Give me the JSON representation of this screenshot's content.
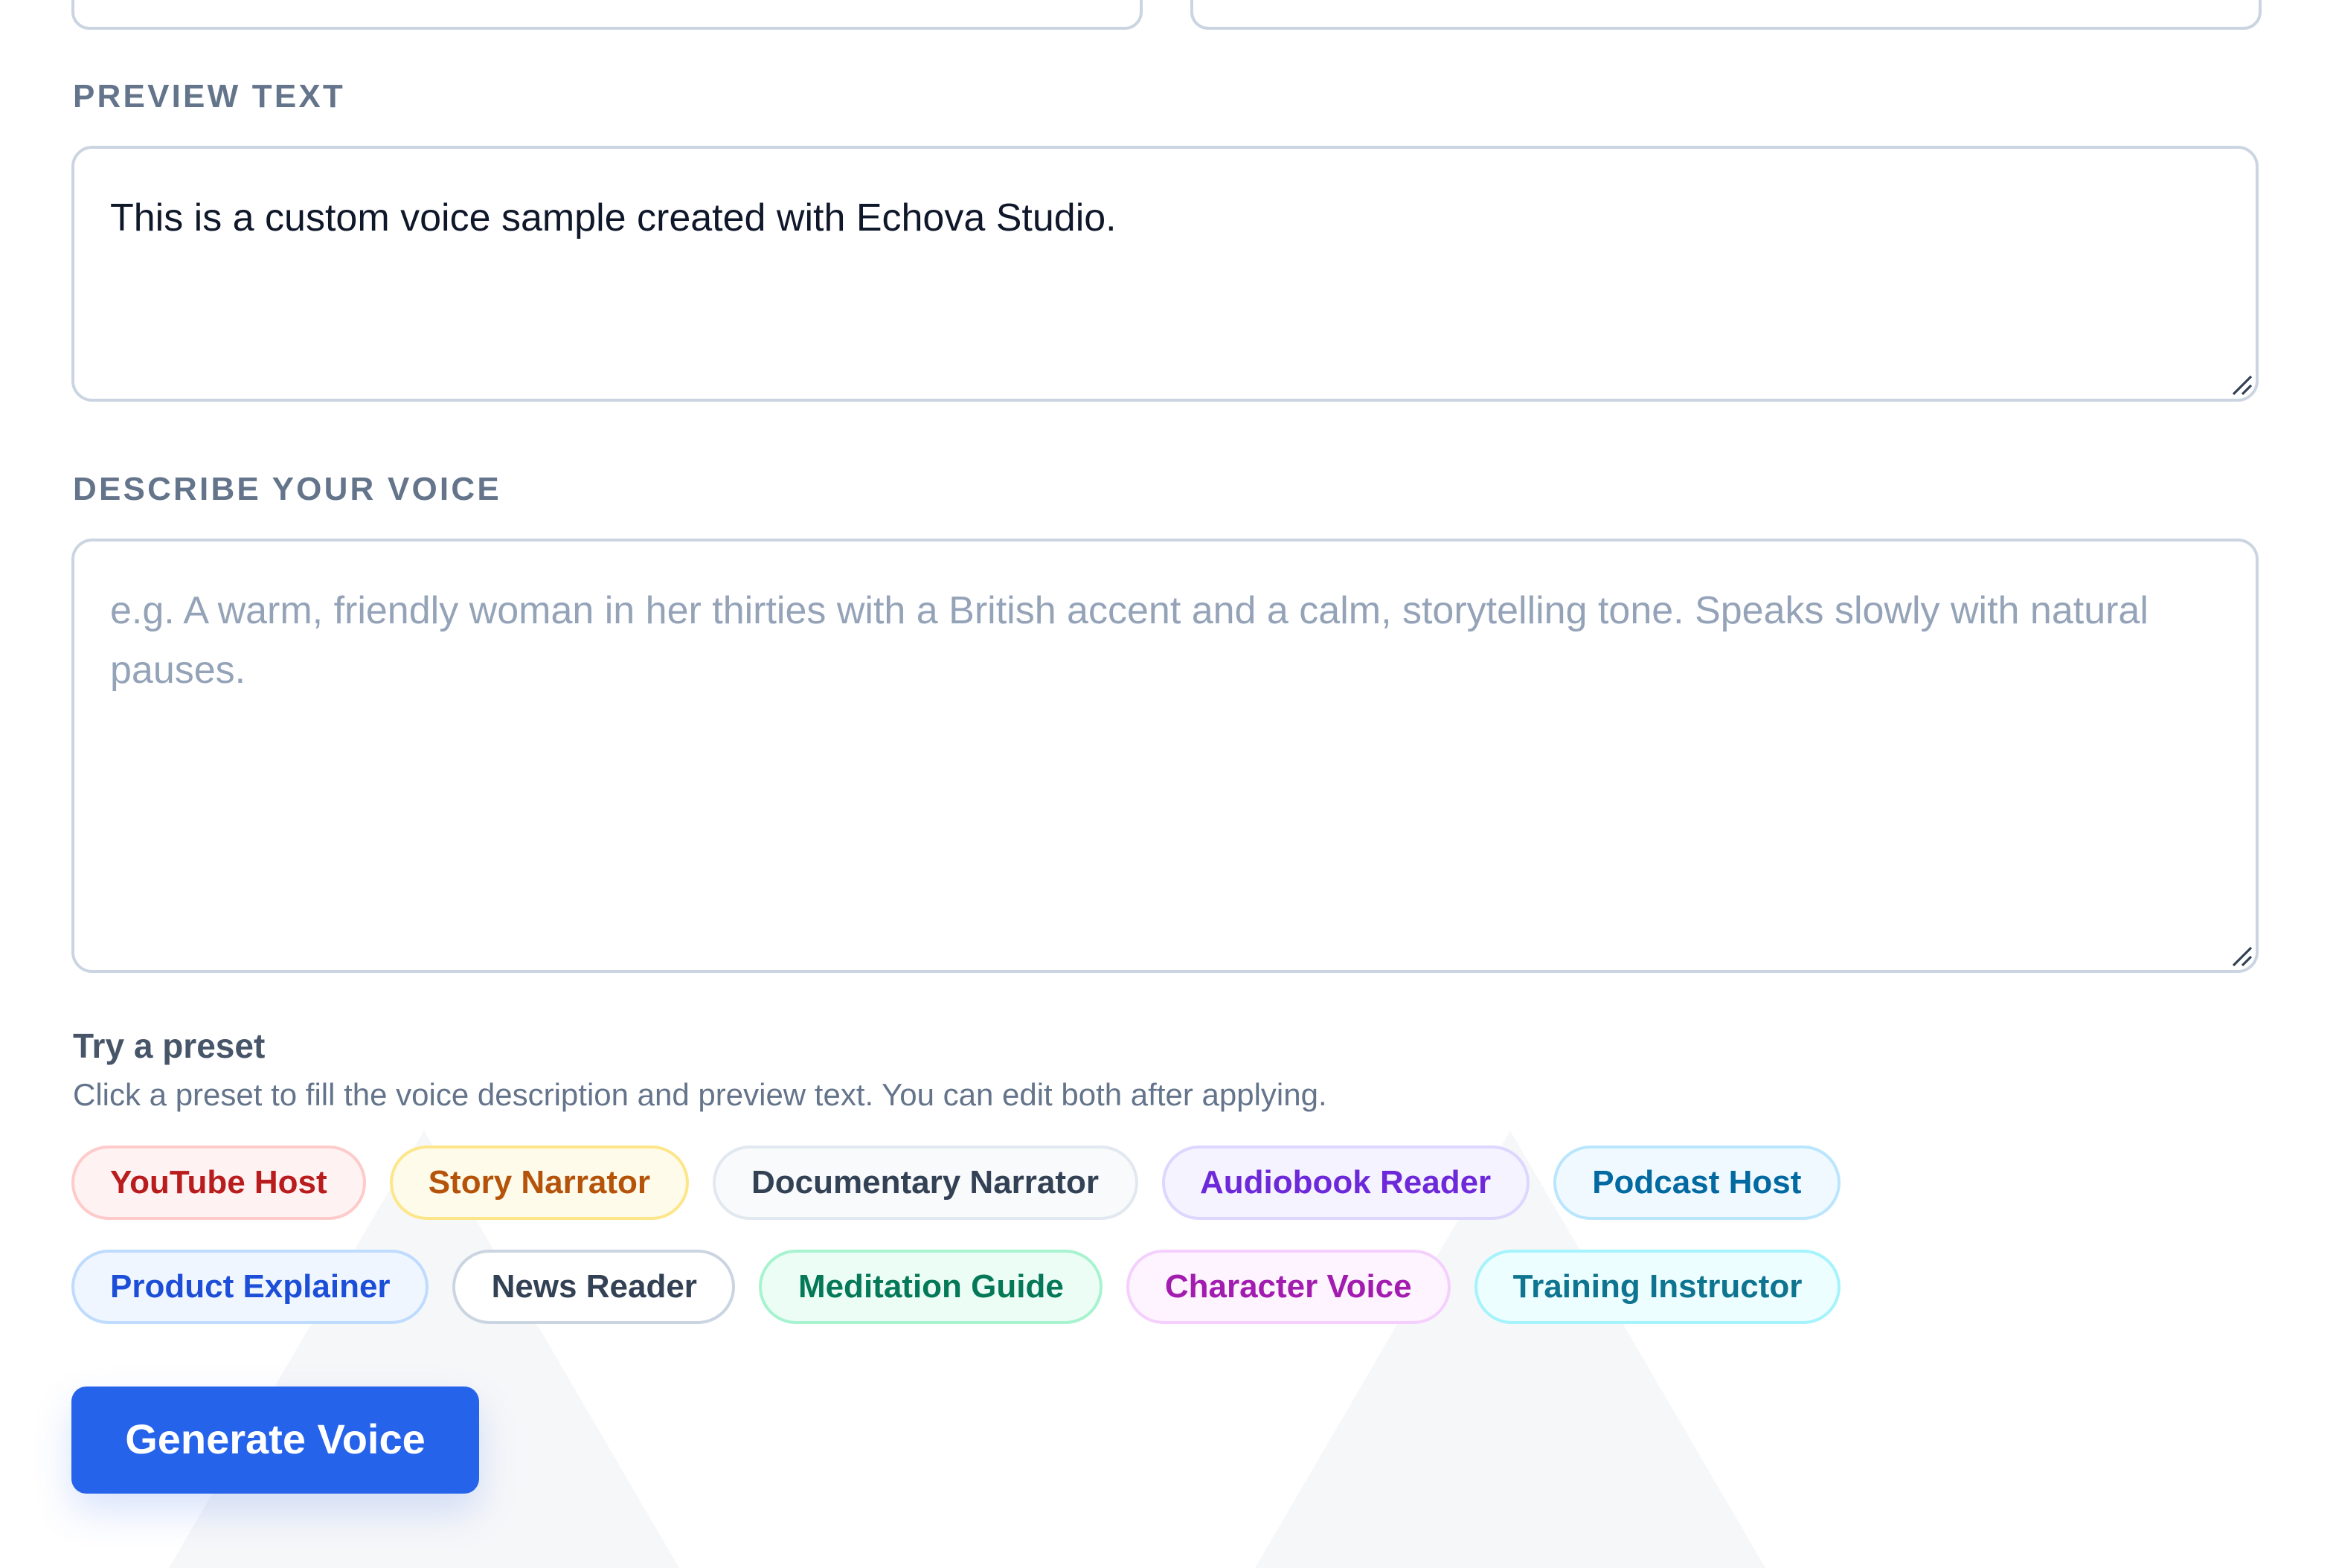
{
  "preview_text": {
    "label": "PREVIEW TEXT",
    "value": "This is a custom voice sample created with Echova Studio."
  },
  "describe_voice": {
    "label": "DESCRIBE YOUR VOICE",
    "placeholder": "e.g. A warm, friendly woman in her thirties with a British accent and a calm, storytelling tone. Speaks slowly with natural pauses."
  },
  "presets": {
    "title": "Try a preset",
    "subtitle": "Click a preset to fill the voice description and preview text. You can edit both after applying.",
    "row1": [
      {
        "label": "YouTube Host",
        "color": "#b91c1c"
      },
      {
        "label": "Story Narrator",
        "color": "#b45309"
      },
      {
        "label": "Documentary Narrator",
        "color": "#334155"
      },
      {
        "label": "Audiobook Reader",
        "color": "#6d28d9"
      },
      {
        "label": "Podcast Host",
        "color": "#0369a1"
      }
    ],
    "row2": [
      {
        "label": "Product Explainer",
        "color": "#1d4ed8"
      },
      {
        "label": "News Reader",
        "color": "#334155"
      },
      {
        "label": "Meditation Guide",
        "color": "#047857"
      },
      {
        "label": "Character Voice",
        "color": "#a21caf"
      },
      {
        "label": "Training Instructor",
        "color": "#0e7490"
      }
    ]
  },
  "generate_button": {
    "label": "Generate Voice",
    "color": "#2563eb"
  }
}
